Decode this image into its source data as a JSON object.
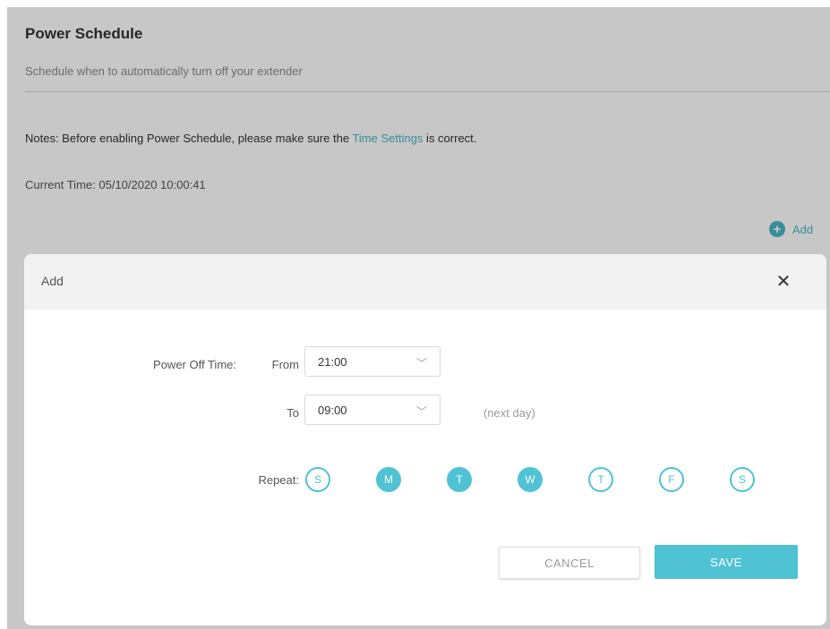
{
  "page": {
    "title": "Power Schedule",
    "subtitle": "Schedule when to automatically turn off your extender",
    "notes_prefix": "Notes: Before enabling Power Schedule, please make sure the ",
    "notes_link": "Time Settings",
    "notes_suffix": " is correct.",
    "current_time_label": "Current Time:",
    "current_time_value": "05/10/2020 10:00:41",
    "add_label": "Add"
  },
  "modal": {
    "title": "Add",
    "close_icon": "close-icon",
    "power_off_label": "Power Off Time:",
    "from_label": "From",
    "from_value": "21:00",
    "to_label": "To",
    "to_value": "09:00",
    "next_day": "(next day)",
    "repeat_label": "Repeat:",
    "days": [
      {
        "letter": "S",
        "selected": false
      },
      {
        "letter": "M",
        "selected": true
      },
      {
        "letter": "T",
        "selected": true
      },
      {
        "letter": "W",
        "selected": true
      },
      {
        "letter": "T",
        "selected": false
      },
      {
        "letter": "F",
        "selected": false
      },
      {
        "letter": "S",
        "selected": false
      }
    ],
    "cancel_label": "CANCEL",
    "save_label": "SAVE"
  },
  "colors": {
    "accent": "#4fc3d3",
    "link": "#4ab5c4"
  }
}
